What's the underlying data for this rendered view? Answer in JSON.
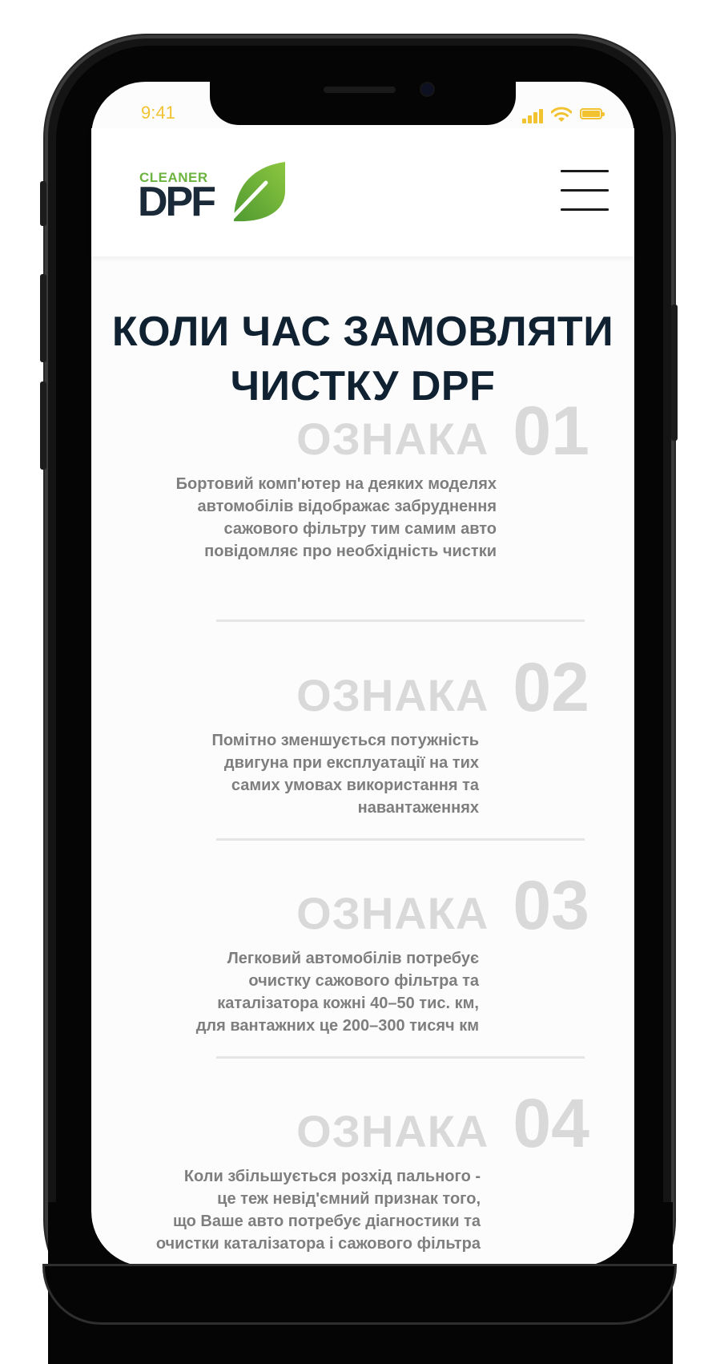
{
  "status_bar": {
    "time": "9:41",
    "icons": [
      "signal-icon",
      "wifi-icon",
      "battery-icon"
    ],
    "color": "#f2c230"
  },
  "header": {
    "logo": {
      "top_text": "CLEANER",
      "main_text": "DPF",
      "green": "#6cb33f",
      "dark": "#1b2a38"
    },
    "menu_icon": "hamburger-menu-icon"
  },
  "main": {
    "title_line1": "КОЛИ ЧАС ЗАМОВЛЯТИ",
    "title_line2": "ЧИСТКУ DPF",
    "signs": [
      {
        "word": "ОЗНАКА",
        "number": "01",
        "lines": [
          "Бортовий комп'ютер на деяких моделях",
          "автомобілів відображає забруднення",
          "сажового фільтру тим самим авто",
          "повідомляє про необхідність чистки"
        ]
      },
      {
        "word": "ОЗНАКА",
        "number": "02",
        "lines": [
          "Помітно зменшується потужність",
          "двигуна при експлуатації на тих",
          "самих умовах використання та",
          "навантаженнях"
        ]
      },
      {
        "word": "ОЗНАКА",
        "number": "03",
        "lines": [
          "Легковий автомобілів потребує",
          "очистку сажового фільтра та",
          "каталізатора кожні 40–50 тис. км,",
          "для вантажних це 200–300 тисяч км"
        ]
      },
      {
        "word": "ОЗНАКА",
        "number": "04",
        "lines": [
          "Коли збільшується розхід пального -",
          "це теж невід'ємний признак того,",
          "що Ваше авто потребує діагностики та",
          "очистки каталізатора і сажового фільтра"
        ]
      }
    ]
  }
}
